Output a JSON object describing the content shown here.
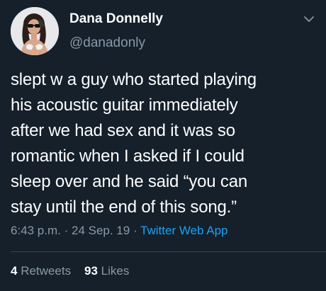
{
  "author": {
    "name": "Dana Donnelly",
    "handle": "@danadonly"
  },
  "tweet": {
    "lines": [
      "slept w a guy who started playing",
      "his acoustic guitar immediately",
      "after we had sex and it was so",
      "romantic when I asked if I could",
      "sleep over and he said “you can",
      "stay until the end of this song.”"
    ]
  },
  "meta": {
    "time": "6:43 p.m.",
    "sep1": " · ",
    "date": "24 Sep. 19",
    "sep2": " · ",
    "source": "Twitter Web App"
  },
  "stats": {
    "retweets_count": "4",
    "retweets_label": "Retweets",
    "likes_count": "93",
    "likes_label": "Likes"
  },
  "icons": {
    "menu": "chevron-down-icon"
  },
  "colors": {
    "background": "#15202b",
    "text": "#ffffff",
    "secondary_text": "#8899a6",
    "link": "#1da1f2",
    "divider": "#38444d"
  }
}
